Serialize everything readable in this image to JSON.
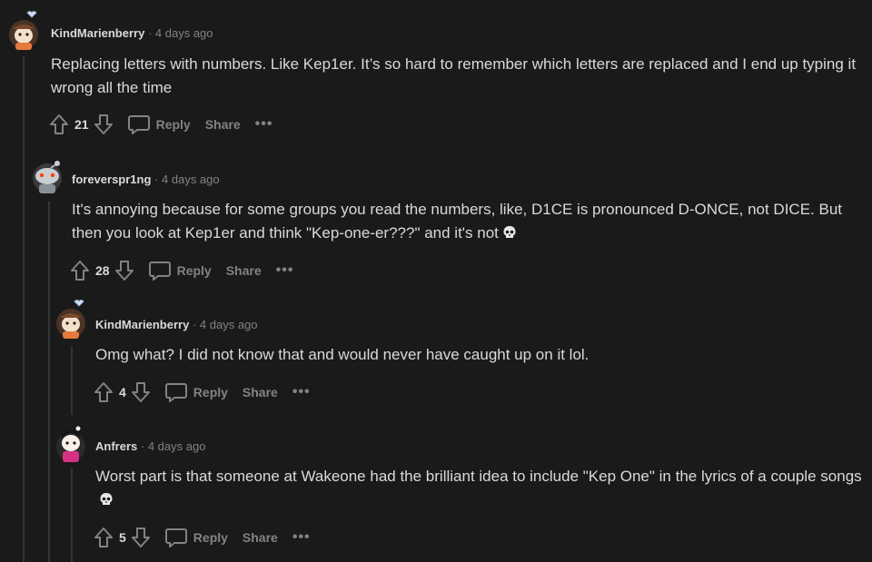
{
  "comments": [
    {
      "author": "KindMarienberry",
      "separator": "·",
      "time": "4 days ago",
      "body": "Replacing letters with numbers. Like Kep1er. It’s so hard to remember which letters are replaced and I end up typing it wrong all the time",
      "score": "21",
      "reply_label": "Reply",
      "share_label": "Share",
      "more_label": "•••",
      "avatar_icon": "snoo-avatar-brown-hair-icon",
      "has_skull": false
    },
    {
      "author": "foreverspr1ng",
      "separator": "·",
      "time": "4 days ago",
      "body": "It's annoying because for some groups you read the numbers, like, D1CE is pronounced D-ONCE, not DICE. But then you look at Kep1er and think \"Kep-one-er???\" and it's not",
      "score": "28",
      "reply_label": "Reply",
      "share_label": "Share",
      "more_label": "•••",
      "avatar_icon": "snoo-avatar-gray-icon",
      "has_skull": true
    },
    {
      "author": "KindMarienberry",
      "separator": "·",
      "time": "4 days ago",
      "body": "Omg what? I did not know that and would never have caught up on it lol.",
      "score": "4",
      "reply_label": "Reply",
      "share_label": "Share",
      "more_label": "•••",
      "avatar_icon": "snoo-avatar-brown-hair-icon",
      "has_skull": false
    },
    {
      "author": "Anfrers",
      "separator": "·",
      "time": "4 days ago",
      "body": "Worst part is that someone at Wakeone had the brilliant idea to include \"Kep One\" in the lyrics of a couple songs",
      "score": "5",
      "reply_label": "Reply",
      "share_label": "Share",
      "more_label": "•••",
      "avatar_icon": "snoo-avatar-pink-icon",
      "has_skull": true
    }
  ],
  "colors": {
    "background": "#1a1a1b",
    "text": "#d7dadc",
    "muted": "#818384",
    "thread_line": "#343536"
  }
}
